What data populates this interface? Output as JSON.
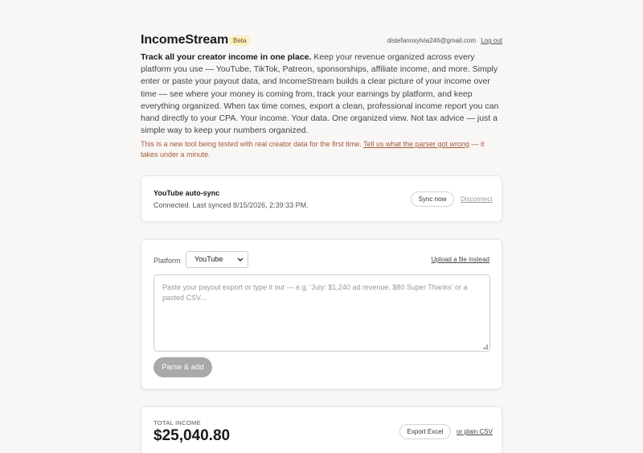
{
  "header": {
    "brand": "IncomeStream",
    "badge": "Beta",
    "email": "distefanosylvia246@gmail.com",
    "logout": "Log out"
  },
  "intro": {
    "lead": "Track all your creator income in one place.",
    "body": " Keep your revenue organized across every platform you use — YouTube, TikTok, Patreon, sponsorships, affiliate income, and more. Simply enter or paste your payout data, and IncomeStream builds a clear picture of your income over time — see where your money is coming from, track your earnings by platform, and keep everything organized. When tax time comes, export a clean, professional income report you can hand directly to your CPA. Your income. Your data. One organized view. Not tax advice — just a simple way to keep your numbers organized."
  },
  "notice": {
    "before": "This is a new tool being tested with real creator data for the first time. ",
    "link": "Tell us what the parser got wrong",
    "after": " — it takes under a minute."
  },
  "sync": {
    "title": "YouTube auto-sync",
    "status": "Connected. Last synced 8/15/2026, 2:39:33 PM.",
    "sync_now": "Sync now",
    "disconnect": "Disconnect"
  },
  "entry": {
    "platform_label": "Platform",
    "platform_value": "YouTube",
    "upload_link": "Upload a file instead",
    "placeholder": "Paste your payout export or type it out — e.g. 'July: $1,240 ad revenue. $80 Super Thanks' or a pasted CSV...",
    "parse_button": "Parse & add"
  },
  "totals": {
    "label": "TOTAL INCOME",
    "value": "$25,040.80",
    "export_excel": "Export Excel",
    "plain_csv": "or plain CSV"
  }
}
